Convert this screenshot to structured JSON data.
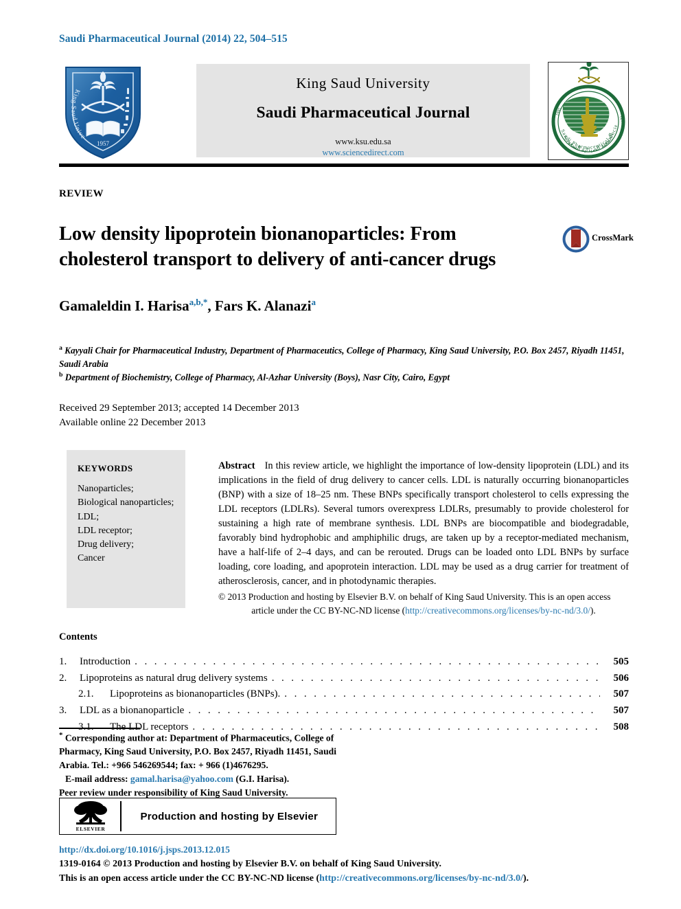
{
  "running_head": "Saudi Pharmaceutical Journal (2014) 22, 504–515",
  "masthead": {
    "university": "King Saud University",
    "journal": "Saudi Pharmaceutical Journal",
    "url_ksu": "www.ksu.edu.sa",
    "url_sciencedirect": "www.sciencedirect.com",
    "ksu_logo_alt": "King Saud University",
    "ksu_logo_year": "1957",
    "sps_logo_alt": "Saudi Pharmaceutical Society"
  },
  "article": {
    "type_label": "REVIEW",
    "title_line1": "Low density lipoprotein bionanoparticles: From",
    "title_line2": "cholesterol transport to delivery of anti-cancer drugs",
    "crossmark_label": "CrossMark",
    "author1_name": "Gamaleldin I. Harisa",
    "author1_sup": "a,b,*",
    "author_separator": ", ",
    "author2_name": "Fars K. Alanazi",
    "author2_sup": "a",
    "affiliation_a_sup": "a",
    "affiliation_a": "Kayyali Chair for Pharmaceutical Industry, Department of Pharmaceutics, College of Pharmacy, King Saud University, P.O. Box 2457, Riyadh 11451, Saudi Arabia",
    "affiliation_b_sup": "b",
    "affiliation_b": "Department of Biochemistry, College of Pharmacy, Al-Azhar University (Boys), Nasr City, Cairo, Egypt",
    "received_line": "Received 29 September 2013; accepted 14 December 2013",
    "available_line": "Available online 22 December 2013"
  },
  "keywords": {
    "heading": "KEYWORDS",
    "items": [
      "Nanoparticles;",
      "Biological nanoparticles;",
      "LDL;",
      "LDL receptor;",
      "Drug delivery;",
      "Cancer"
    ]
  },
  "abstract": {
    "label": "Abstract",
    "body": "In this review article, we highlight the importance of low-density lipoprotein (LDL) and its implications in the field of drug delivery to cancer cells. LDL is naturally occurring bionanoparticles (BNP) with a size of 18–25 nm. These BNPs specifically transport cholesterol to cells expressing the LDL receptors (LDLRs). Several tumors overexpress LDLRs, presumably to provide cholesterol for sustaining a high rate of membrane synthesis. LDL BNPs are biocompatible and biodegradable, favorably bind hydrophobic and amphiphilic drugs, are taken up by a receptor-mediated mechanism, have a half-life of 2–4 days, and can be rerouted. Drugs can be loaded onto LDL BNPs by surface loading, core loading, and apoprotein interaction. LDL may be used as a drug carrier for treatment of atherosclerosis, cancer, and in photodynamic therapies.",
    "copyright_prefix": "© 2013 Production and hosting by Elsevier B.V. on behalf of King Saud University. This is an open access",
    "license_text": "article under the CC BY-NC-ND license (",
    "license_url": "http://creativecommons.org/licenses/by-nc-nd/3.0/",
    "license_suffix": ")."
  },
  "contents": {
    "heading": "Contents",
    "entries": [
      {
        "num": "1.",
        "sub": "",
        "label": "Introduction",
        "page": "505",
        "indent": false
      },
      {
        "num": "2.",
        "sub": "",
        "label": "Lipoproteins as natural drug delivery systems",
        "page": "506",
        "indent": false
      },
      {
        "num": "",
        "sub": "2.1.",
        "label": "Lipoproteins as bionanoparticles (BNPs).",
        "page": "507",
        "indent": true
      },
      {
        "num": "3.",
        "sub": "",
        "label": "LDL as a bionanoparticle",
        "page": "507",
        "indent": false
      },
      {
        "num": "",
        "sub": "3.1.",
        "label": "The LDL receptors",
        "page": "508",
        "indent": true
      }
    ],
    "dot_leader": ". . . . . . . . . . . . . . . . . . . . . . . . . . . . . . . . . . . . . . . . . . . . . . . . . . . . . . . . . . . . . . . . . . . . . . . . . . . . . . . . . . . . . . . . . . . . . . . . . . . . . ."
  },
  "footnote": {
    "star": "*",
    "corresponding": "Corresponding author at: Department of Pharmaceutics, College of Pharmacy, King Saud University, P.O. Box 2457, Riyadh 11451, Saudi Arabia. Tel.: +966 546269544; fax: + 966 (1)4676295.",
    "email_label": "E-mail address:",
    "email": "gamal.harisa@yahoo.com",
    "email_owner": "(G.I. Harisa).",
    "peer_review": "Peer review under responsibility of King Saud University."
  },
  "elsevier_box": {
    "logo_word": "ELSEVIER",
    "text": "Production and hosting by Elsevier"
  },
  "footer": {
    "doi": "http://dx.doi.org/10.1016/j.jsps.2013.12.015",
    "line1": "1319-0164 © 2013 Production and hosting by Elsevier B.V. on behalf of King Saud University.",
    "line2_prefix": "This is an open access article under the CC BY-NC-ND license (",
    "line2_url": "http://creativecommons.org/licenses/by-nc-nd/3.0/",
    "line2_suffix": ")."
  },
  "colors": {
    "link_blue": "#2a7ab0",
    "header_blue": "#1a6ea5",
    "banner_gray": "#e4e4e4",
    "seal_green": "#1d6b3a",
    "crossmark_red": "#a02b22"
  }
}
